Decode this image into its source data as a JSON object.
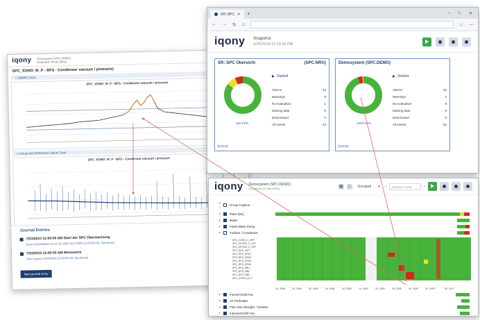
{
  "left_window": {
    "logo": "iqony",
    "meta_lines": [
      "Demosystem (SPC.DEMO)",
      "Evaluated: 90 Ids (99%)"
    ],
    "title": "SPC_XONO_M_P - BFS - Condenser vacuum / pressure)",
    "section1": "> SMMR Chart",
    "chart1_caption": "SPC_XONO_M_P - BFS - Condenser vacuum / pressure",
    "section2": "> Actual and Reference Value Chart",
    "chart2_caption": "SPC_XONO_M_P - BFS - Condenser vacuum / pressure",
    "journal": {
      "title": "Journal Entries",
      "entries": [
        {
          "head": "7/23/2010 12:00:00 AM   Start der SPC Überwachung",
          "sub": "Neue Kontrolldaten am 11.02.2009 (3/17/2009 12:00:00 AM, SpcAdmin)"
        },
        {
          "head": "7/23/2010 12:00:00 AM   Messwerte",
          "sub": "Filter ergänzt (3/20/2009 12:00:00 AM, SpcAdmin)"
        }
      ],
      "button": "New journal entry"
    }
  },
  "browser": {
    "tab_label": "SR::SPC",
    "win_controls": [
      "–",
      "□",
      "✕"
    ],
    "logo": "iqony",
    "snapshot_label": "Snapshot",
    "snapshot_date": "2/25/2016 12:29:33 PM"
  },
  "cards": [
    {
      "title": "SR::SPC Übersicht",
      "code": "(SPC.NRG)",
      "started": "Started",
      "kpis": "160 KPIs",
      "home": "[Home]",
      "stats": [
        {
          "label": "Alarms",
          "value": "14"
        },
        {
          "label": "Warnings",
          "value": "9"
        },
        {
          "label": "No evaluation",
          "value": "1"
        },
        {
          "label": "Missing data",
          "value": "0"
        },
        {
          "label": "Deactivated",
          "value": "0"
        },
        {
          "label": "All events",
          "value": "24"
        }
      ],
      "donut": [
        {
          "color": "#48b33b",
          "frac": 0.85
        },
        {
          "color": "#e9e023",
          "frac": 0.08
        },
        {
          "color": "#d7261e",
          "frac": 0.07
        }
      ]
    },
    {
      "title": "Demosystem (SPC.DEMO)",
      "code": "",
      "started": "Started",
      "kpis": "1032 KPIs",
      "home": "[Home]",
      "stats": [
        {
          "label": "Alarms",
          "value": "52"
        },
        {
          "label": "Warnings",
          "value": "2"
        },
        {
          "label": "No evaluation",
          "value": "8"
        },
        {
          "label": "Missing data",
          "value": "0"
        },
        {
          "label": "Deactivated",
          "value": "0"
        },
        {
          "label": "All events",
          "value": "62"
        }
      ],
      "donut": [
        {
          "color": "#48b33b",
          "frac": 0.95
        },
        {
          "color": "#d7261e",
          "frac": 0.04
        },
        {
          "color": "#e9e023",
          "frac": 0.01
        }
      ]
    }
  ],
  "bottom_window": {
    "logo": "iqony",
    "title": "Demosystem (SPC.DEMO)",
    "subtitle": "Computed: 90 IIds (99%)",
    "view": "Grouped",
    "date_value": "3/30/2012 23:55",
    "groups": [
      {
        "label": "Group Caption",
        "pm": "+ −",
        "outline": true
      },
      {
        "label": "Plant (ML)",
        "pm": "+"
      },
      {
        "label": "Boiler",
        "pm": "+"
      },
      {
        "label": "Feed-Water Pump",
        "pm": "+"
      },
      {
        "label": "Turbine / Condensor",
        "pm": "+"
      }
    ],
    "signals": [
      "SPC_XONO_C_EFF",
      "SPC_RFXSS_C_EFF",
      "SPC_MTSSS_C_EFF",
      "SPC_BFS_VMT",
      "SPC_BFS_DRS1",
      "SPC_BFS_DRS2",
      "SPC_BFS_DRS3",
      "SPC_BFS_DRS4",
      "SPC_BFS_MB1",
      "SPC_BFS_MB2",
      "SPC_BFS_MB3",
      "SPC_XONO_M_P"
    ],
    "axis_labels": [
      "14. 2008",
      "24. 2008",
      "34. 2008",
      "44. 2008",
      "04. 2009",
      "14. 2009",
      "24. 2009",
      "34. 2009",
      "40. 2009",
      "41. 2009",
      "06. 2011"
    ],
    "lower_groups": [
      {
        "label": "Forced Draft Fan",
        "pm": "+"
      },
      {
        "label": "Air Preheater",
        "pm": "+"
      },
      {
        "label": "Flue Gas Desulph. / DeNOx",
        "pm": "+"
      },
      {
        "label": "Induced Draft Fan",
        "pm": "+"
      }
    ]
  }
}
